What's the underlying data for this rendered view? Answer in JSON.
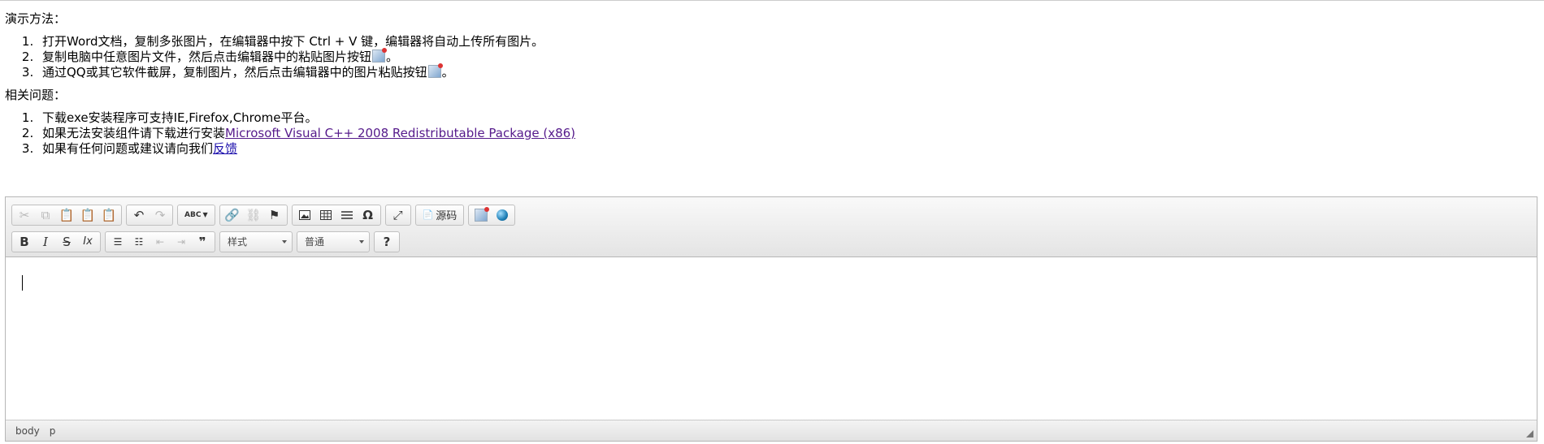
{
  "intro": {
    "demo_heading": "演示方法：",
    "demo_items": [
      "打开Word文档，复制多张图片，在编辑器中按下 Ctrl + V 键，编辑器将自动上传所有图片。",
      "复制电脑中任意图片文件，然后点击编辑器中的粘贴图片按钮",
      "通过QQ或其它软件截屏，复制图片，然后点击编辑器中的图片粘贴按钮"
    ],
    "period": "。",
    "faq_heading": "相关问题：",
    "faq_item1": "下载exe安装程序可支持IE,Firefox,Chrome平台。",
    "faq_item2_prefix": "如果无法安装组件请下载进行安装",
    "faq_item2_link": "Microsoft Visual C++ 2008 Redistributable Package (x86)",
    "faq_item3_prefix": "如果有任何问题或建议请向我们",
    "faq_item3_link": "反馈"
  },
  "toolbar": {
    "icons_row1": [
      "cut-icon",
      "copy-icon",
      "paste-icon",
      "paste-text-icon",
      "paste-word-icon",
      "undo-icon",
      "redo-icon",
      "spellcheck-icon",
      "link-icon",
      "unlink-icon",
      "anchor-icon",
      "image-icon",
      "table-icon",
      "horizontal-rule-icon",
      "special-char-icon",
      "maximize-icon",
      "paste-image-icon",
      "globe-icon"
    ],
    "spellcheck_glyph": "ABC",
    "special_char_glyph": "Ω",
    "source_label": "源码",
    "bold": "B",
    "italic": "I",
    "strike": "S",
    "remove_format": "Ix",
    "blockquote_glyph": "❞",
    "style_combo": "样式",
    "format_combo": "普通",
    "help": "?"
  },
  "statusbar": {
    "path": [
      "body",
      "p"
    ]
  }
}
